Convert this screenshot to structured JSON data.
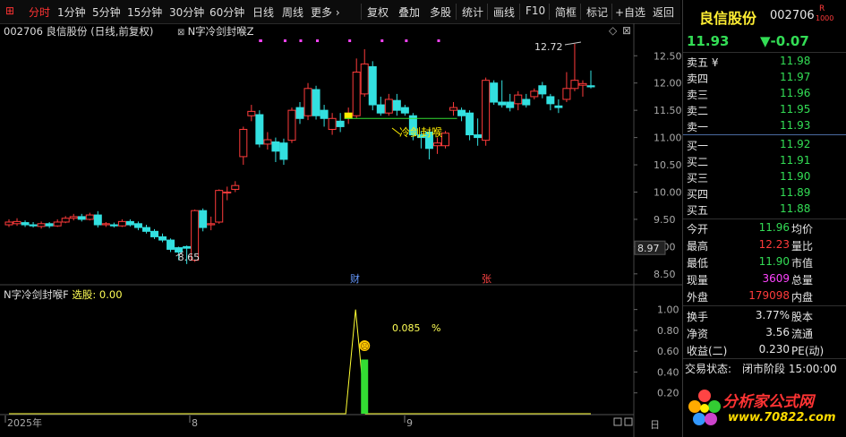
{
  "toolbar": {
    "items": [
      "分时",
      "1分钟",
      "5分钟",
      "15分钟",
      "30分钟",
      "60分钟",
      "日线",
      "周线",
      "更多 ›",
      "复权",
      "叠加",
      "多股",
      "统计",
      "画线",
      "F10",
      "简框",
      "标记",
      "+自选",
      "返回"
    ],
    "active_index": 0
  },
  "chart_header": {
    "title": "002706 良信股份 (日线,前复权)",
    "formula_label": "N字冷剑封喉Z"
  },
  "indicator_header": {
    "title": "N字冷剑封喉F",
    "pick_label": "选股:",
    "pick_value": "0.00"
  },
  "price_axis": {
    "ticks": [
      "12.50",
      "12.00",
      "11.50",
      "11.00",
      "10.50",
      "10.00",
      "9.50",
      "9.00",
      "8.50"
    ],
    "current_label": "8.97"
  },
  "indicator_axis": {
    "ticks": [
      "1.00",
      "0.80",
      "0.60",
      "0.40",
      "0.20"
    ]
  },
  "time_axis": {
    "labels": [
      "2025年",
      "8",
      "9"
    ],
    "right_label": "日"
  },
  "annotations": {
    "high_label": "12.72",
    "low_label": "8.65",
    "signal_text": "冷剑封喉",
    "event_cai": "财",
    "event_zhang": "张",
    "ind_value": "0.085",
    "ind_unit": "%",
    "face_icon": "☹"
  },
  "chart_data": {
    "type": "candlestick",
    "title": "",
    "ylim": [
      8.3,
      12.8
    ],
    "candles": [
      {
        "o": 9.4,
        "c": 9.45,
        "h": 9.5,
        "l": 9.36
      },
      {
        "o": 9.42,
        "c": 9.46,
        "h": 9.52,
        "l": 9.38
      },
      {
        "o": 9.44,
        "c": 9.4,
        "h": 9.48,
        "l": 9.36
      },
      {
        "o": 9.4,
        "c": 9.38,
        "h": 9.45,
        "l": 9.35
      },
      {
        "o": 9.37,
        "c": 9.42,
        "h": 9.46,
        "l": 9.33
      },
      {
        "o": 9.42,
        "c": 9.38,
        "h": 9.45,
        "l": 9.34
      },
      {
        "o": 9.38,
        "c": 9.45,
        "h": 9.5,
        "l": 9.36
      },
      {
        "o": 9.45,
        "c": 9.52,
        "h": 9.56,
        "l": 9.43
      },
      {
        "o": 9.52,
        "c": 9.55,
        "h": 9.6,
        "l": 9.48
      },
      {
        "o": 9.55,
        "c": 9.5,
        "h": 9.6,
        "l": 9.46
      },
      {
        "o": 9.5,
        "c": 9.58,
        "h": 9.62,
        "l": 9.48
      },
      {
        "o": 9.58,
        "c": 9.4,
        "h": 9.65,
        "l": 9.35
      },
      {
        "o": 9.4,
        "c": 9.42,
        "h": 9.45,
        "l": 9.36
      },
      {
        "o": 9.4,
        "c": 9.38,
        "h": 9.44,
        "l": 9.35
      },
      {
        "o": 9.38,
        "c": 9.46,
        "h": 9.5,
        "l": 9.36
      },
      {
        "o": 9.46,
        "c": 9.4,
        "h": 9.5,
        "l": 9.37
      },
      {
        "o": 9.42,
        "c": 9.35,
        "h": 9.46,
        "l": 9.3
      },
      {
        "o": 9.35,
        "c": 9.28,
        "h": 9.4,
        "l": 9.24
      },
      {
        "o": 9.28,
        "c": 9.18,
        "h": 9.32,
        "l": 9.14
      },
      {
        "o": 9.18,
        "c": 9.12,
        "h": 9.24,
        "l": 9.08
      },
      {
        "o": 9.12,
        "c": 8.95,
        "h": 9.15,
        "l": 8.9
      },
      {
        "o": 8.98,
        "c": 8.9,
        "h": 9.0,
        "l": 8.75
      },
      {
        "o": 9.0,
        "c": 8.97,
        "h": 9.02,
        "l": 8.68
      },
      {
        "o": 8.75,
        "c": 9.66,
        "h": 9.68,
        "l": 8.72
      },
      {
        "o": 9.66,
        "c": 9.35,
        "h": 9.7,
        "l": 9.28
      },
      {
        "o": 9.4,
        "c": 9.42,
        "h": 9.55,
        "l": 9.3
      },
      {
        "o": 9.45,
        "c": 10.03,
        "h": 10.05,
        "l": 9.42
      },
      {
        "o": 10.0,
        "c": 10.0,
        "h": 10.1,
        "l": 9.85
      },
      {
        "o": 10.05,
        "c": 10.12,
        "h": 10.2,
        "l": 10.0
      },
      {
        "o": 10.65,
        "c": 11.15,
        "h": 11.2,
        "l": 10.5
      },
      {
        "o": 11.4,
        "c": 11.48,
        "h": 11.6,
        "l": 11.3
      },
      {
        "o": 11.42,
        "c": 10.88,
        "h": 11.5,
        "l": 10.82
      },
      {
        "o": 10.88,
        "c": 10.96,
        "h": 11.1,
        "l": 10.78
      },
      {
        "o": 10.92,
        "c": 10.75,
        "h": 11.0,
        "l": 10.55
      },
      {
        "o": 10.9,
        "c": 10.6,
        "h": 10.98,
        "l": 10.5
      },
      {
        "o": 10.95,
        "c": 11.5,
        "h": 11.55,
        "l": 10.9
      },
      {
        "o": 11.55,
        "c": 11.35,
        "h": 11.65,
        "l": 11.25
      },
      {
        "o": 11.4,
        "c": 11.9,
        "h": 12.0,
        "l": 11.32
      },
      {
        "o": 11.88,
        "c": 11.4,
        "h": 11.95,
        "l": 11.33
      },
      {
        "o": 11.5,
        "c": 11.35,
        "h": 11.6,
        "l": 11.2
      },
      {
        "o": 11.15,
        "c": 11.35,
        "h": 11.45,
        "l": 11.05
      },
      {
        "o": 11.3,
        "c": 11.2,
        "h": 11.45,
        "l": 11.1
      },
      {
        "o": 11.35,
        "c": 11.45,
        "h": 11.55,
        "l": 11.25
      },
      {
        "o": 11.4,
        "c": 12.2,
        "h": 12.45,
        "l": 11.35
      },
      {
        "o": 11.8,
        "c": 12.35,
        "h": 12.62,
        "l": 11.75
      },
      {
        "o": 12.3,
        "c": 11.6,
        "h": 12.4,
        "l": 11.5
      },
      {
        "o": 11.6,
        "c": 11.45,
        "h": 11.75,
        "l": 11.4
      },
      {
        "o": 11.45,
        "c": 11.7,
        "h": 11.8,
        "l": 11.4
      },
      {
        "o": 11.68,
        "c": 11.5,
        "h": 11.8,
        "l": 11.4
      },
      {
        "o": 11.55,
        "c": 11.45,
        "h": 11.6,
        "l": 11.4
      },
      {
        "o": 11.4,
        "c": 11.05,
        "h": 11.45,
        "l": 10.95
      },
      {
        "o": 11.05,
        "c": 11.0,
        "h": 11.12,
        "l": 10.8
      },
      {
        "o": 11.1,
        "c": 10.8,
        "h": 11.15,
        "l": 10.6
      },
      {
        "o": 10.85,
        "c": 10.9,
        "h": 11.0,
        "l": 10.7
      },
      {
        "o": 10.85,
        "c": 11.08,
        "h": 11.12,
        "l": 10.8
      },
      {
        "o": 11.5,
        "c": 11.55,
        "h": 11.65,
        "l": 11.4
      },
      {
        "o": 11.5,
        "c": 11.4,
        "h": 11.55,
        "l": 11.3
      },
      {
        "o": 11.45,
        "c": 11.05,
        "h": 11.5,
        "l": 10.95
      },
      {
        "o": 11.05,
        "c": 11.0,
        "h": 11.35,
        "l": 10.85
      },
      {
        "o": 10.95,
        "c": 12.05,
        "h": 12.1,
        "l": 10.85
      },
      {
        "o": 12.0,
        "c": 11.65,
        "h": 12.05,
        "l": 11.6
      },
      {
        "o": 11.65,
        "c": 11.6,
        "h": 12.05,
        "l": 11.55
      },
      {
        "o": 11.65,
        "c": 11.55,
        "h": 11.8,
        "l": 11.48
      },
      {
        "o": 11.62,
        "c": 11.78,
        "h": 11.85,
        "l": 11.5
      },
      {
        "o": 11.7,
        "c": 11.6,
        "h": 11.8,
        "l": 11.55
      },
      {
        "o": 11.75,
        "c": 11.85,
        "h": 11.9,
        "l": 11.7
      },
      {
        "o": 11.95,
        "c": 11.8,
        "h": 12.02,
        "l": 11.72
      },
      {
        "o": 11.75,
        "c": 11.62,
        "h": 11.8,
        "l": 11.5
      },
      {
        "o": 11.58,
        "c": 11.55,
        "h": 11.7,
        "l": 11.45
      },
      {
        "o": 11.7,
        "c": 11.9,
        "h": 12.2,
        "l": 11.65
      },
      {
        "o": 11.9,
        "c": 12.05,
        "h": 12.72,
        "l": 11.85
      },
      {
        "o": 11.96,
        "c": 11.99,
        "h": 12.05,
        "l": 11.75
      },
      {
        "o": 11.95,
        "c": 11.93,
        "h": 12.23,
        "l": 11.9
      }
    ],
    "support_line": {
      "value": 11.35
    },
    "signal_candles": [
      42,
      43
    ],
    "indicator": {
      "series_name": "选股",
      "spike_index": 43,
      "spike_value": 1.0,
      "bar_index": 44,
      "bar_value": 0.52,
      "ylim": [
        0,
        1.1
      ]
    }
  },
  "quote": {
    "name": "良信股份",
    "code": "002706",
    "badge_top": "R",
    "badge_bottom": "1000",
    "price": "11.93",
    "change": "▼-0.07",
    "sells": [
      {
        "label": "卖五 ¥",
        "price": "11.98"
      },
      {
        "label": "卖四",
        "price": "11.97"
      },
      {
        "label": "卖三",
        "price": "11.96"
      },
      {
        "label": "卖二",
        "price": "11.95"
      },
      {
        "label": "卖一",
        "price": "11.93"
      }
    ],
    "buys": [
      {
        "label": "买一",
        "price": "11.92"
      },
      {
        "label": "买二",
        "price": "11.91"
      },
      {
        "label": "买三",
        "price": "11.90"
      },
      {
        "label": "买四",
        "price": "11.89"
      },
      {
        "label": "买五",
        "price": "11.88"
      }
    ],
    "stats": [
      {
        "l1": "今开",
        "v1": "11.96",
        "c1": "green",
        "l2": "均价"
      },
      {
        "l1": "最高",
        "v1": "12.23",
        "c1": "red",
        "l2": "量比"
      },
      {
        "l1": "最低",
        "v1": "11.90",
        "c1": "green",
        "l2": "市值"
      },
      {
        "l1": "现量",
        "v1": "3609",
        "c1": "magenta",
        "l2": "总量"
      },
      {
        "l1": "外盘",
        "v1": "179098",
        "c1": "red",
        "l2": "内盘"
      }
    ],
    "stats2": [
      {
        "l1": "换手",
        "v1": "3.77%",
        "l2": "股本"
      },
      {
        "l1": "净资",
        "v1": "3.56",
        "l2": "流通"
      },
      {
        "l1": "收益(二)",
        "v1": "0.230",
        "l2": "PE(动)"
      }
    ],
    "status_label": "交易状态:",
    "status_value": "闭市阶段 15:00:00"
  },
  "watermark": {
    "line1": "分析家公式网",
    "line2": "www.70822.com"
  }
}
